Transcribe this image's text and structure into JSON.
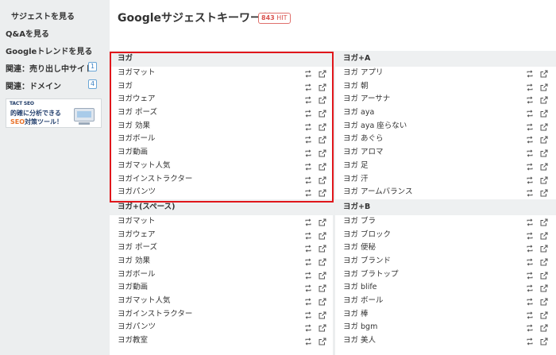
{
  "sidebar": {
    "items": [
      {
        "label": "サジェストを見る"
      },
      {
        "label": "Q&Aを見る"
      },
      {
        "label": "Googleトレンドを見る"
      },
      {
        "label": "関連：売り出し中サイト",
        "count": "1"
      },
      {
        "label": "関連：ドメイン",
        "count": "4"
      }
    ],
    "banner": {
      "logo": "TACT SEO",
      "line1": "的確に分析できる",
      "line2_accent": "SEO",
      "line2_rest": "対策ツール！"
    }
  },
  "header": {
    "title": "Googleサジェストキーワード",
    "hit_count": "843",
    "hit_unit": "HIT"
  },
  "sections": {
    "left_top": {
      "title": "ヨガ",
      "rows": [
        "ヨガマット",
        "ヨガ",
        "ヨガウェア",
        "ヨガ ポーズ",
        "ヨガ 効果",
        "ヨガボール",
        "ヨガ動画",
        "ヨガマット人気",
        "ヨガインストラクター",
        "ヨガパンツ"
      ]
    },
    "right_top": {
      "title": "ヨガ+A",
      "rows": [
        "ヨガ アプリ",
        "ヨガ 朝",
        "ヨガ アーサナ",
        "ヨガ aya",
        "ヨガ aya 座らない",
        "ヨガ あぐら",
        "ヨガ アロマ",
        "ヨガ 足",
        "ヨガ 汗",
        "ヨガ アームバランス"
      ]
    },
    "left_bottom": {
      "title": "ヨガ+(スペース)",
      "rows": [
        "ヨガマット",
        "ヨガウェア",
        "ヨガ ポーズ",
        "ヨガ 効果",
        "ヨガボール",
        "ヨガ動画",
        "ヨガマット人気",
        "ヨガインストラクター",
        "ヨガパンツ",
        "ヨガ教室"
      ]
    },
    "right_bottom": {
      "title": "ヨガ+B",
      "rows": [
        "ヨガ ブラ",
        "ヨガ ブロック",
        "ヨガ 便秘",
        "ヨガ ブランド",
        "ヨガ ブラトップ",
        "ヨガ blife",
        "ヨガ ボール",
        "ヨガ 棒",
        "ヨガ bgm",
        "ヨガ 美人"
      ]
    }
  },
  "icons": {
    "row_action_1": "swap-icon",
    "row_action_2": "open-external-icon"
  },
  "colors": {
    "highlight_border": "#e0161b",
    "hit_badge": "#d9534f",
    "count_badge": "#3c82c4"
  }
}
